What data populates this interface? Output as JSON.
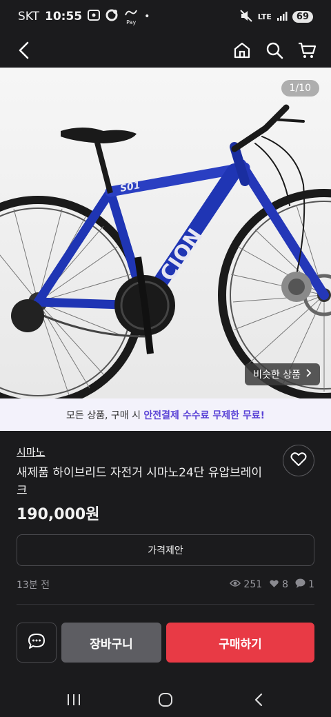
{
  "status_bar": {
    "carrier": "SKT",
    "time": "10:55",
    "pay_label": "Pay",
    "network": "LTE",
    "battery": "69"
  },
  "nav": {
    "icons": [
      "back-icon",
      "home-icon",
      "search-icon",
      "cart-icon"
    ]
  },
  "gallery": {
    "counter": "1/10",
    "similar_label": "비슷한 상품",
    "bike_brand_text": "CION",
    "bike_model_text": "S01"
  },
  "promo": {
    "prefix": "모든 상품, 구매 시 ",
    "highlight": "안전결제 수수료 무제한 무료!"
  },
  "product": {
    "seller": "시마노",
    "title": "새제품 하이브리드 자전거 시마노24단 유압브레이크",
    "price": "190,000원",
    "offer_label": "가격제안",
    "posted": "13분 전",
    "views": "251",
    "likes": "8",
    "chats": "1"
  },
  "actions": {
    "cart_label": "장바구니",
    "buy_label": "구매하기"
  },
  "colors": {
    "background": "#1b1b1d",
    "buy": "#e83a45",
    "cart": "#5d5d62",
    "promo_highlight": "#5a43d6",
    "bike_frame": "#1f35b4"
  }
}
